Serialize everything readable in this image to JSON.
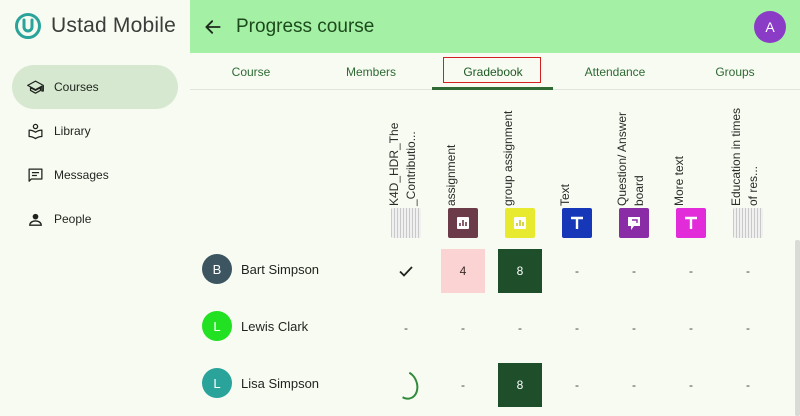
{
  "app": {
    "brand": "Ustad Mobile",
    "colors": {
      "header": "#a4f0a4",
      "active_nav": "#d6e8cf",
      "accent": "#2f6a35",
      "avatar": "#8a3cc7"
    }
  },
  "sidebar": {
    "items": [
      {
        "label": "Courses",
        "icon": "school-icon",
        "active": true
      },
      {
        "label": "Library",
        "icon": "library-icon",
        "active": false
      },
      {
        "label": "Messages",
        "icon": "messages-icon",
        "active": false
      },
      {
        "label": "People",
        "icon": "person-icon",
        "active": false
      }
    ]
  },
  "header": {
    "title": "Progress course",
    "avatar_initial": "A"
  },
  "tabs": [
    {
      "label": "Course"
    },
    {
      "label": "Members"
    },
    {
      "label": "Gradebook",
      "active": true
    },
    {
      "label": "Attendance"
    },
    {
      "label": "Groups"
    }
  ],
  "gradebook": {
    "columns": [
      {
        "title": "K4D_HDR_The _Contributio...",
        "icon": "thumbnail-icon",
        "color": ""
      },
      {
        "title": "assignment",
        "icon": "assignment-icon",
        "color": "#6b3b4a"
      },
      {
        "title": "group assignment",
        "icon": "assignment-icon",
        "color": "#e8ea2f"
      },
      {
        "title": "Text",
        "icon": "text-icon",
        "color": "#1638b8"
      },
      {
        "title": "Question/ Answer board",
        "icon": "discussion-icon",
        "color": "#8a2ca6"
      },
      {
        "title": "More text",
        "icon": "text-icon",
        "color": "#e22bd9"
      },
      {
        "title": "Education in times of res...",
        "icon": "thumbnail-icon",
        "color": ""
      }
    ],
    "rows": [
      {
        "name": "Bart Simpson",
        "initial": "B",
        "avatar_color": "#3c5560",
        "cells": [
          "check",
          "4",
          "8",
          "-",
          "-",
          "-",
          "-"
        ]
      },
      {
        "name": "Lewis Clark",
        "initial": "L",
        "avatar_color": "#22e022",
        "cells": [
          "-",
          "-",
          "-",
          "-",
          "-",
          "-",
          "-"
        ]
      },
      {
        "name": "Lisa Simpson",
        "initial": "L",
        "avatar_color": "#2aa39a",
        "cells": [
          "progress",
          "-",
          "8",
          "-",
          "-",
          "-",
          "-"
        ]
      }
    ]
  }
}
